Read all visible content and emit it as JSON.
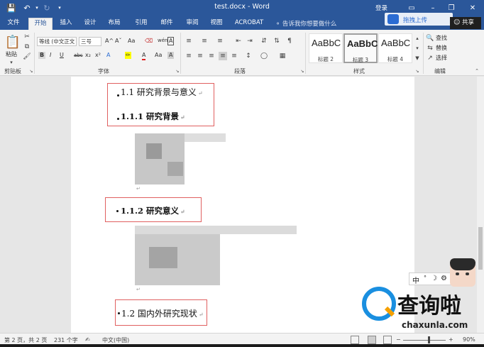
{
  "window": {
    "title": "test.docx - Word",
    "login_label": "登录",
    "quick_access": {
      "save_icon": "save-icon",
      "undo_icon": "undo-icon",
      "redo_icon": "redo-icon"
    },
    "controls": {
      "ribbon_display_glyph": "▭",
      "minimize_glyph": "–",
      "restore_glyph": "❐",
      "close_glyph": "✕"
    }
  },
  "tabs": [
    {
      "label": "文件",
      "active": false
    },
    {
      "label": "开始",
      "active": true
    },
    {
      "label": "插入",
      "active": false
    },
    {
      "label": "设计",
      "active": false
    },
    {
      "label": "布局",
      "active": false
    },
    {
      "label": "引用",
      "active": false
    },
    {
      "label": "邮件",
      "active": false
    },
    {
      "label": "审阅",
      "active": false
    },
    {
      "label": "视图",
      "active": false
    },
    {
      "label": "ACROBAT",
      "active": false
    }
  ],
  "tell_me": {
    "icon": "lightbulb-icon",
    "placeholder": "告诉我你想要做什么"
  },
  "upload": {
    "label": "拖拽上传"
  },
  "share": {
    "label": "共享",
    "icon": "person-icon"
  },
  "ribbon": {
    "clipboard": {
      "paste_label": "粘贴",
      "group_label": "剪贴板"
    },
    "font": {
      "font_name": "等线 (中文正文",
      "font_size": "三号",
      "group_label": "字体",
      "buttons": [
        "B",
        "I",
        "U",
        "abc",
        "x₂",
        "x²",
        "A",
        "Aa",
        "A",
        "A"
      ],
      "grow_label": "A^",
      "shrink_label": "Aˇ",
      "clear_format_label": "Aa",
      "phonetic_label": "wén",
      "char_border_label": "A"
    },
    "paragraph": {
      "group_label": "段落"
    },
    "styles": {
      "group_label": "样式",
      "items": [
        {
          "sample": "AaBbC",
          "name": "标题 2",
          "selected": false,
          "bold": false
        },
        {
          "sample": "AaBbC",
          "name": "标题 3",
          "selected": true,
          "bold": true
        },
        {
          "sample": "AaBbC",
          "name": "标题 4",
          "selected": false,
          "bold": false
        }
      ]
    },
    "editing": {
      "group_label": "编辑",
      "find_label": "查找",
      "replace_label": "替换",
      "select_label": "选择"
    }
  },
  "document": {
    "headings": [
      {
        "text": "1.1 研究背景与意义",
        "bold": false
      },
      {
        "text": "1.1.1 研究背景",
        "bold": true
      },
      {
        "text": "1.1.2 研究意义",
        "bold": true
      },
      {
        "text": "1.2 国内外研究现状",
        "bold": false
      }
    ],
    "paragraph_mark": "↵"
  },
  "ime": {
    "mode_char": "中",
    "punct_char": "°",
    "moon_char": "☽",
    "gear_icon": "gear-icon"
  },
  "watermark": {
    "brand_text": "查询啦",
    "url_text": "chaxunla.com"
  },
  "status": {
    "page": "第 2 页，共 2 页",
    "words": "231 个字",
    "language": "中文(中国)",
    "zoom": "90%",
    "zoom_fraction": 0.6
  },
  "colors": {
    "accent": "#2b579a",
    "highlight_box": "#e06060",
    "watermark_blue": "#1a8fe0"
  }
}
